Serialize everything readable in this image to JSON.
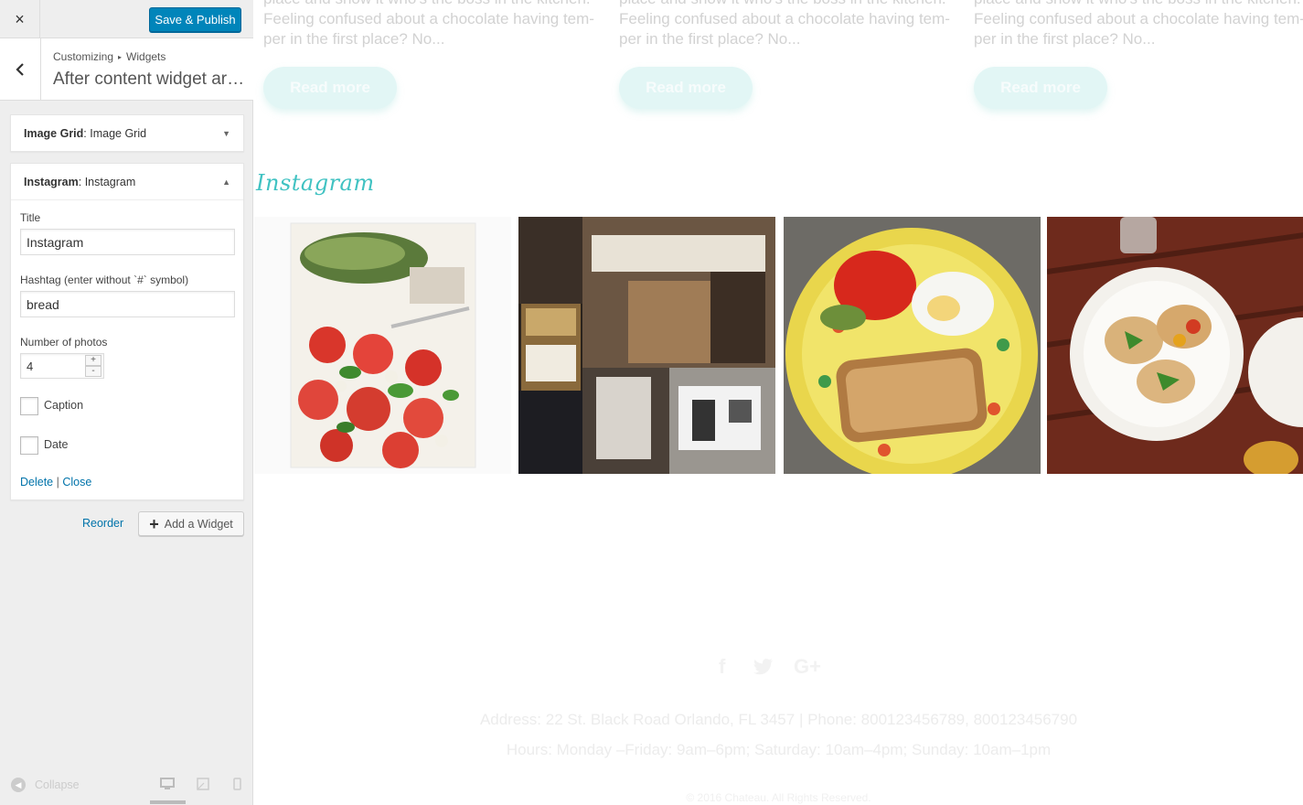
{
  "header": {
    "close_label": "×",
    "save_publish_label": "Save & Publish"
  },
  "section": {
    "breadcrumb_root": "Customizing",
    "breadcrumb_sep": "▸",
    "breadcrumb_current": "Widgets",
    "title": "After content widget area"
  },
  "widgets": [
    {
      "type": "Image Grid",
      "name": "Image Grid",
      "state": "collapsed"
    },
    {
      "type": "Instagram",
      "name": "Instagram",
      "state": "expanded"
    }
  ],
  "instagram_form": {
    "title_label": "Title",
    "title_value": "Instagram",
    "hashtag_label": "Hashtag (enter without `#` symbol)",
    "hashtag_value": "bread",
    "photos_label": "Number of photos",
    "photos_value": "4",
    "caption_label": "Caption",
    "caption_checked": false,
    "date_label": "Date",
    "date_checked": false,
    "delete_label": "Delete",
    "link_sep": "|",
    "close_label": "Close"
  },
  "actions": {
    "reorder_label": "Reorder",
    "add_widget_label": "Add a Widget"
  },
  "footer": {
    "collapse_label": "Collapse",
    "devices": [
      "desktop-icon",
      "tablet-icon",
      "mobile-icon"
    ]
  },
  "preview": {
    "posts": [
      {
        "line1": "place and show it who's the boss in the kitchen.",
        "line2": "Feeling confused about a chocolate having tem-",
        "line3": "per in the first place? No...",
        "button": "Read more"
      },
      {
        "line1": "place and show it who's the boss in the kitchen.",
        "line2": "Feeling confused about a chocolate having tem-",
        "line3": "per in the first place? No...",
        "button": "Read more"
      },
      {
        "line1": "place and show it who's the boss in the kitchen.",
        "line2": "Feeling confused about a chocolate having tem-",
        "line3": "per in the first place? No...",
        "button": "Read more"
      }
    ],
    "instagram_heading": "Instagram",
    "photos": [
      "salad-photo",
      "cafe-collage-photo",
      "toast-plate-photo",
      "bruschetta-photo"
    ],
    "social_icons": [
      "facebook-icon",
      "twitter-icon",
      "google-plus-icon"
    ],
    "address": "Address: 22 St. Black Road Orlando, FL 3457 | Phone: 800123456789, 800123456790",
    "hours": "Hours: Monday –Friday: 9am–6pm; Saturday: 10am–4pm; Sunday: 10am–1pm",
    "copyright": "© 2016 Chateau. All Rights Reserved."
  },
  "colors": {
    "primary_button": "#0085ba",
    "link": "#0073aa",
    "accent_teal": "#40c2c2",
    "read_more_bg": "#e2f6f5"
  }
}
